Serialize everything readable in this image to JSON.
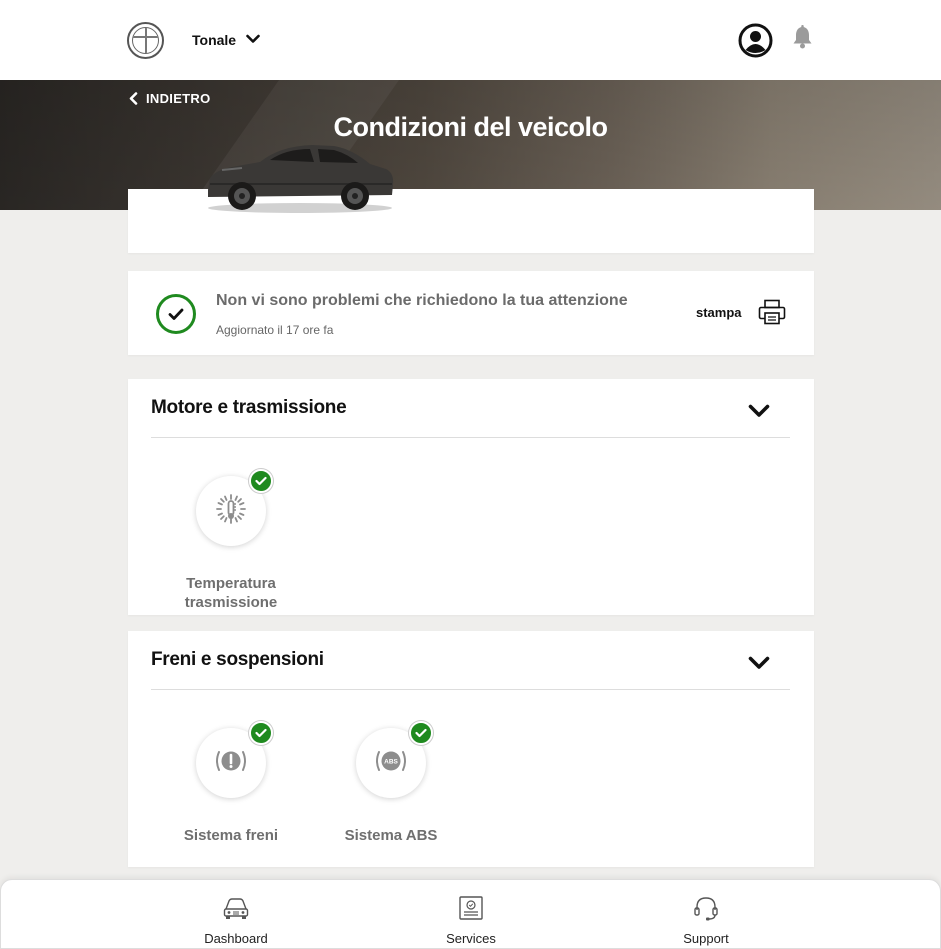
{
  "header": {
    "vehicle_name": "Tonale"
  },
  "hero": {
    "back_label": "INDIETRO",
    "title": "Condizioni del veicolo"
  },
  "status": {
    "message": "Non vi sono problemi che richiedono la tua attenzione",
    "updated": "Aggiornato il 17 ore fa",
    "print_label": "stampa"
  },
  "sections": [
    {
      "title": "Motore e trasmissione",
      "items": [
        {
          "label_line1": "Temperatura",
          "label_line2": "trasmissione",
          "icon": "transmission-temperature-icon",
          "status": "ok"
        }
      ]
    },
    {
      "title": "Freni e sospensioni",
      "items": [
        {
          "label_line1": "Sistema freni",
          "icon": "brake-warning-icon",
          "status": "ok"
        },
        {
          "label_line1": "Sistema ABS",
          "icon": "abs-icon",
          "status": "ok"
        }
      ]
    }
  ],
  "bottom_nav": [
    {
      "label": "Dashboard",
      "icon": "car-icon"
    },
    {
      "label": "Services",
      "icon": "services-icon"
    },
    {
      "label": "Support",
      "icon": "headset-icon"
    }
  ],
  "colors": {
    "ok_green": "#1f8a1f",
    "background": "#efeeec"
  }
}
